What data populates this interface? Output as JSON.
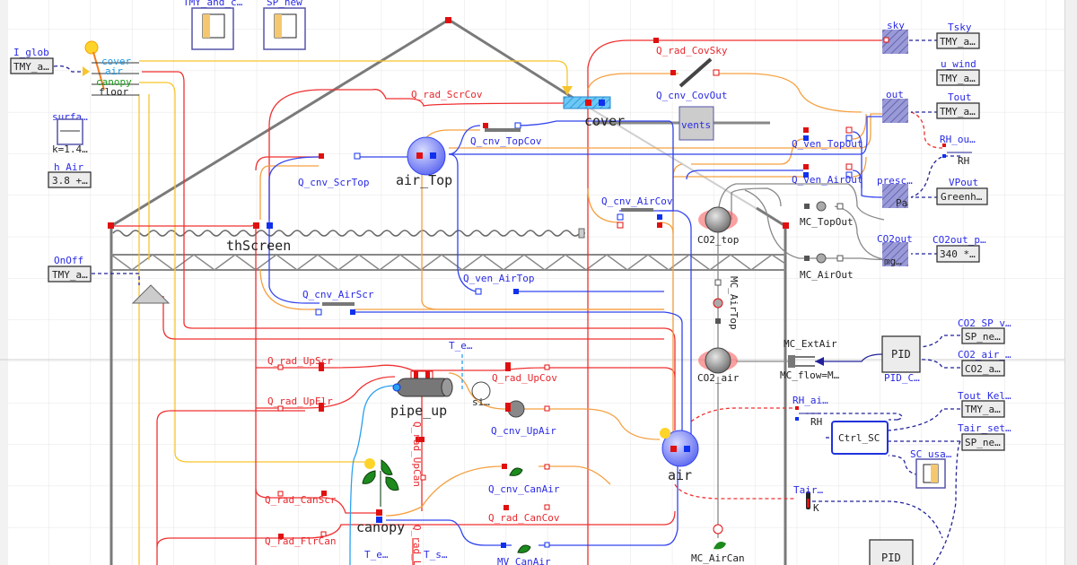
{
  "colors": {
    "heat_radiation": "#f03030",
    "convection": "#f5a040",
    "mass_flow": "#3344ee",
    "solar": "#f7c52a",
    "co2": "#888888",
    "signal": "#22229a",
    "label_blue": "#2a2ae6"
  },
  "sources": {
    "I_glob": {
      "name": "I_glob",
      "value": "TMY_a…"
    },
    "TMY_and_c": {
      "name": "TMY_and_c…",
      "icon": "table-icon"
    },
    "SP_new": {
      "name": "SP_new",
      "icon": "table-icon"
    },
    "surface": {
      "name": "surfa…",
      "param": "k=1.4…"
    },
    "h_Air": {
      "name": "h_Air",
      "value": "3.8 +…"
    },
    "OnOff": {
      "name": "OnOff",
      "value": "TMY_a…"
    },
    "Tsky": {
      "name": "Tsky",
      "value": "TMY_a…"
    },
    "u_wind": {
      "name": "u_wind",
      "value": "TMY_a…"
    },
    "Tout": {
      "name": "Tout",
      "value": "TMY_a…"
    },
    "RH_out": {
      "name": "RH_ou…",
      "unit": "RH"
    },
    "VPout": {
      "name": "VPout",
      "value": "Greenh…"
    },
    "CO2out_ppm": {
      "name": "CO2out_p…",
      "value": "340 *…"
    },
    "CO2_SP": {
      "name": "CO2_SP_v…",
      "value": "SP_ne…"
    },
    "CO2_air_in": {
      "name": "CO2_air_…",
      "value": "CO2_a…"
    },
    "Tout_Kelvin": {
      "name": "Tout_Kel…",
      "value": "TMY_a…"
    },
    "Tair_setpoint": {
      "name": "Tair_set…",
      "value": "SP_ne…"
    },
    "SC_usable": {
      "name": "SC_usa…",
      "icon": "table-icon"
    }
  },
  "solar_model": {
    "ports": [
      "cover",
      "air",
      "canopy",
      "floor"
    ]
  },
  "components": {
    "Q_rad_ScrCov": "Q_rad_ScrCov",
    "Q_cnv_TopCov": "Q_cnv_TopCov",
    "air_Top": "air_Top",
    "Q_cnv_ScrTop": "Q_cnv_ScrTop",
    "thScreen": "thScreen",
    "cover": "cover",
    "Q_rad_CovSky": "Q_rad_CovSky",
    "Q_cnv_CovOut": "Q_cnv_CovOut",
    "vents": "vents",
    "Q_ven_TopOut": "Q_ven_TopOut",
    "Q_ven_AirOut": "Q_ven_AirOut",
    "Q_cnv_AirCov": "Q_cnv_AirCov",
    "CO2_top": "CO2_top",
    "MC_TopOut": "MC_TopOut",
    "MC_AirOut": "MC_AirOut",
    "sky": "sky",
    "out": "out",
    "presc": "presc…",
    "Pa": "Pa",
    "CO2out": "CO2out",
    "CO2out_unit": "mg…",
    "Q_ven_AirTop": "Q_ven_AirTop",
    "Q_cnv_AirScr": "Q_cnv_AirScr",
    "MC_AirTop": "MC_AirTop",
    "CO2_air": "CO2_air",
    "MC_ExtAir": "MC_ExtAir",
    "MC_flow": "MC_flow=M…",
    "PID_CO2": "PID",
    "PID_CO2_name": "PID_C…",
    "RH_air": "RH_ai…",
    "RH_unit": "RH",
    "Ctrl_SC": "Ctrl_SC",
    "Tair": "Tair…",
    "K_unit": "K",
    "PID_bottom": "PID",
    "Q_rad_UpScr": "Q_rad_UpScr",
    "Q_rad_UpElr": "Q_rad_UpElr",
    "Q_rad_CanScr": "Q_rad_CanScr",
    "Q_rad_FlrCan": "Q_rad_FlrCan",
    "pipe_up": "pipe_up",
    "T_e_top": "T_e…",
    "Q_rad_UpCov": "Q_rad_UpCov",
    "si": "si…",
    "Q_cnv_UpAir": "Q_cnv_UpAir",
    "Q_cnv_CanAir": "Q_cnv_CanAir",
    "Q_rad_CanCov": "Q_rad_CanCov",
    "MV_CanAir": "MV_CanAir",
    "canopy": "canopy",
    "Q_rad_UpCan": "Q_rad_UpCan",
    "Q_rad_bottom": "Q_rad_L…",
    "air": "air",
    "MC_AirCan": "MC_AirCan",
    "T_e_bottom": "T_e…",
    "T_s_bottom": "T_s…"
  }
}
